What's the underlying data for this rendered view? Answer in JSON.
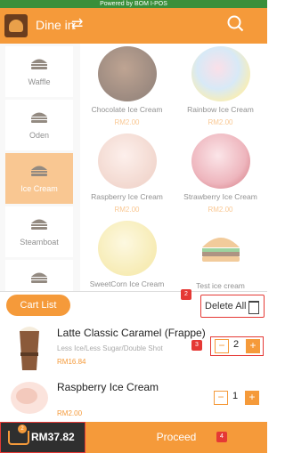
{
  "topbar": {
    "text": "Powered by BOM I-POS"
  },
  "header": {
    "mode": "Dine in"
  },
  "sidebar": {
    "items": [
      {
        "label": "Waffle",
        "active": false
      },
      {
        "label": "Oden",
        "active": false
      },
      {
        "label": "Ice Cream",
        "active": true
      },
      {
        "label": "Steamboat",
        "active": false
      },
      {
        "label": "",
        "active": false
      }
    ]
  },
  "products": [
    {
      "name": "Chocolate Ice Cream",
      "price": "RM2.00"
    },
    {
      "name": "Rainbow Ice Cream",
      "price": "RM2.00"
    },
    {
      "name": "Raspberry  Ice Cream",
      "price": "RM2.00"
    },
    {
      "name": "Strawberry Ice Cream",
      "price": "RM2.00"
    },
    {
      "name": "SweetCorn Ice Cream",
      "price": ""
    },
    {
      "name": "Test ice cream",
      "price": ""
    }
  ],
  "cart": {
    "title": "Cart List",
    "delete_all": "Delete All",
    "items": [
      {
        "name": "Latte Classic Caramel (Frappe)",
        "note": "Less Ice/Less Sugar/Double Shot",
        "price": "RM16.84",
        "qty": "2"
      },
      {
        "name": "Raspberry  Ice Cream",
        "note": "",
        "price": "RM2.00",
        "qty": "1"
      }
    ]
  },
  "footer": {
    "cart_count": "2",
    "total": "RM37.82",
    "proceed": "Proceed"
  },
  "badges": {
    "b1": "1",
    "b2": "2",
    "b3": "3",
    "b4": "4"
  },
  "colors": {
    "accent": "#f59a3a",
    "annotation": "#e53935",
    "topbar": "#3a8f3a"
  }
}
